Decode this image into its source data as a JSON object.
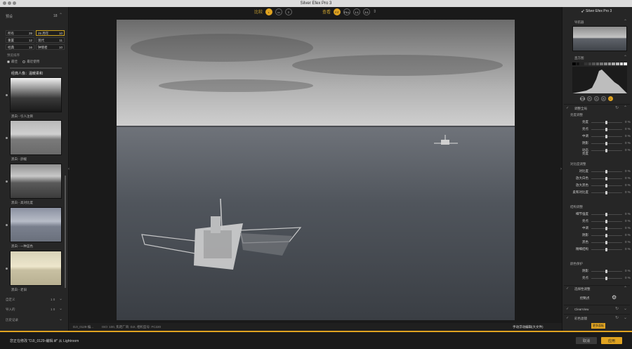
{
  "app": {
    "title": "Silver Efex Pro 3"
  },
  "left_panel": {
    "header": "预设",
    "count": "18",
    "categories": [
      {
        "label": "所有",
        "count": "39",
        "selected": false
      },
      {
        "label": "25 周年",
        "count": "10",
        "selected": true
      },
      {
        "label": "重置",
        "count": "12",
        "selected": false
      },
      {
        "label": "现代",
        "count": "11",
        "selected": false
      },
      {
        "label": "经典",
        "count": "16",
        "selected": false
      },
      {
        "label": "钟情者",
        "count": "10",
        "selected": false
      }
    ],
    "sort_label": "预览排序",
    "sort_options": [
      "最佳",
      "最近使用"
    ],
    "preset_group_title": "经典人像：温暖柔和",
    "presets": [
      {
        "label": "黑白 - 引人注目"
      },
      {
        "label": "黑白 - 舒缓"
      },
      {
        "label": "黑白 - 高对比度"
      },
      {
        "label": "黑白 - 一种蓝色"
      },
      {
        "label": "黑白 - 老旧"
      }
    ],
    "sections": [
      {
        "label": "自定义",
        "count": "1 0"
      },
      {
        "label": "导入的",
        "count": "1 0"
      },
      {
        "label": "历史记录",
        "count": ""
      }
    ]
  },
  "toolbar": {
    "compare_label": "比较",
    "view_label": "查看",
    "zoom_fit": "FIT",
    "zoom_fill": "FILL",
    "zoom_11": "1:1",
    "zoom_31": "3:1"
  },
  "status_bar": {
    "file": "DJI_0129-编...",
    "meta": "ISO: 100, 焦距厂商: DJI, 相机型号: FC220",
    "mode": "手动浮动编辑(大文件)"
  },
  "right_panel": {
    "brand": "Silver Efex Pro 3",
    "navigator": "导航器",
    "histogram": "直方图",
    "hist_buttons": [
      "RGB",
      "R",
      "G",
      "B",
      "L"
    ],
    "global_adjust": "调整全局",
    "brightness_group": "亮度调整",
    "brightness": [
      {
        "label": "亮度",
        "value": "0 %"
      },
      {
        "label": "亮点",
        "value": "0 %"
      },
      {
        "label": "中调",
        "value": "0 %"
      },
      {
        "label": "阴影",
        "value": "0 %"
      },
      {
        "label": "动态\n亮度",
        "value": "0 %"
      }
    ],
    "contrast_group": "对比度调整",
    "contrast": [
      {
        "label": "对比度",
        "value": "0 %"
      },
      {
        "label": "放大白色",
        "value": "0 %"
      },
      {
        "label": "放大黑色",
        "value": "0 %"
      },
      {
        "label": "柔和对比度",
        "value": "0 %"
      }
    ],
    "structure_group": "结构调整",
    "structure": [
      {
        "label": "细节强度",
        "value": "0 %"
      },
      {
        "label": "亮点",
        "value": "0 %"
      },
      {
        "label": "中调",
        "value": "0 %"
      },
      {
        "label": "阴影",
        "value": "0 %"
      },
      {
        "label": "黑色",
        "value": "0 %"
      },
      {
        "label": "精细结构",
        "value": "0 %"
      }
    ],
    "protect_group": "颜色保护",
    "protect": [
      {
        "label": "阴影",
        "value": "0 %"
      },
      {
        "label": "亮点",
        "value": "0 %"
      }
    ],
    "local_adjust": "选择性调整",
    "control_points": "控制点",
    "clearview": "ClearView",
    "color_filter": "彩色滤镜",
    "more_button": "更多面板"
  },
  "bottom_bar": {
    "message": "您正在修改 \"DJI_0129-编辑.tif\" 从 Lightroom",
    "cancel": "取消",
    "apply": "应用"
  }
}
